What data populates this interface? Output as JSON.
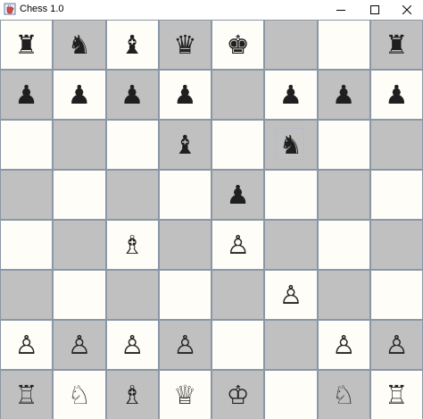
{
  "window": {
    "title": "Chess 1.0",
    "icon": "java-cup-icon"
  },
  "board": {
    "light_color": "#fffdf7",
    "dark_color": "#c0c0c0",
    "highlight_square": "f6",
    "squares": [
      [
        "♜",
        "♞",
        "♝",
        "♛",
        "♚",
        "",
        "",
        "♜"
      ],
      [
        "♟",
        "♟",
        "♟",
        "♟",
        "",
        "♟",
        "♟",
        "♟"
      ],
      [
        "",
        "",
        "",
        "♝",
        "",
        "♞",
        "",
        ""
      ],
      [
        "",
        "",
        "",
        "",
        "♟",
        "",
        "",
        ""
      ],
      [
        "",
        "",
        "♗",
        "",
        "♙",
        "",
        "",
        ""
      ],
      [
        "",
        "",
        "",
        "",
        "",
        "♙",
        "",
        ""
      ],
      [
        "♙",
        "♙",
        "♙",
        "♙",
        "",
        "",
        "♙",
        "♙"
      ],
      [
        "♖",
        "♘",
        "♗",
        "♕",
        "♔",
        "",
        "♘",
        "♖"
      ]
    ]
  }
}
